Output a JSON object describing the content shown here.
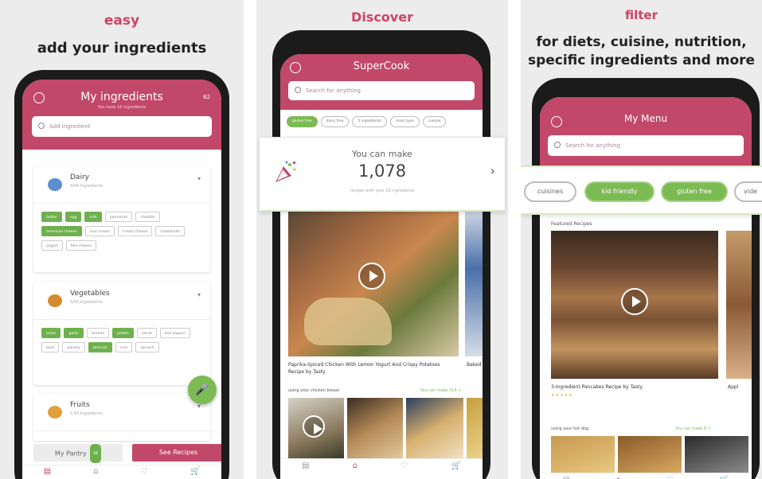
{
  "panel1": {
    "accent": "easy",
    "headline": "add your ingredients",
    "screen": {
      "title": "My ingredients",
      "subtitle": "You have 16 ingredients",
      "count_badge": "62",
      "search_placeholder": "Add ingredient",
      "groups": [
        {
          "name": "Dairy",
          "count": "4/44 Ingredients",
          "icon_color": "#5a8fd1",
          "chips": [
            {
              "label": "butter",
              "on": true
            },
            {
              "label": "egg",
              "on": true
            },
            {
              "label": "milk",
              "on": true
            },
            {
              "label": "parmesan",
              "on": false
            },
            {
              "label": "cheddar",
              "on": false
            },
            {
              "label": "american cheese",
              "on": true
            },
            {
              "label": "sour cream",
              "on": false
            },
            {
              "label": "cream cheese",
              "on": false
            },
            {
              "label": "mozzarella",
              "on": false
            },
            {
              "label": "yogurt",
              "on": false
            },
            {
              "label": "feta cheese",
              "on": false
            }
          ]
        },
        {
          "name": "Vegetables",
          "count": "6/93 Ingredients",
          "icon_color": "#d48a2a",
          "chips": [
            {
              "label": "onion",
              "on": true
            },
            {
              "label": "garlic",
              "on": true
            },
            {
              "label": "tomato",
              "on": false
            },
            {
              "label": "potato",
              "on": true
            },
            {
              "label": "carrot",
              "on": false
            },
            {
              "label": "bell pepper",
              "on": false
            },
            {
              "label": "basil",
              "on": false
            },
            {
              "label": "parsley",
              "on": false
            },
            {
              "label": "broccoli",
              "on": true
            },
            {
              "label": "corn",
              "on": false
            },
            {
              "label": "spinach",
              "on": false
            }
          ]
        },
        {
          "name": "Fruits",
          "count": "1/43 Ingredients",
          "icon_color": "#e0a03a",
          "chips": []
        }
      ],
      "pantry_label": "My Pantry",
      "pantry_badge": "16",
      "see_recipes": "See Recipes",
      "nav": [
        "▤",
        "⌂",
        "♡",
        "🛒"
      ]
    }
  },
  "panel2": {
    "accent": "Discover",
    "screen": {
      "title": "SuperCook",
      "search_placeholder": "Search for anything",
      "tags": [
        {
          "label": "gluten free",
          "on": true
        },
        {
          "label": "dairy free",
          "on": false
        },
        {
          "label": "5 ingredients",
          "on": false
        },
        {
          "label": "meal type",
          "on": false
        },
        {
          "label": "cuisine",
          "on": false
        }
      ],
      "make_label": "You can make",
      "make_count": "1,078",
      "make_sub": "recipes with your 16 ingredients",
      "recipe_title": "Paprika-Spiced Chicken With Lemon Yogurt And Crispy Potatoes Recipe by Tasty",
      "side_title": "Baked",
      "section_label": "using your chicken breast",
      "section_link": "You can make 214 >",
      "nav": [
        "▤",
        "⌂",
        "♡",
        "🛒"
      ]
    }
  },
  "panel3": {
    "accent": "filter",
    "headline": [
      "for diets, cuisine, nutrition,",
      "specific ingredients and more"
    ],
    "screen": {
      "title": "My Menu",
      "search_placeholder": "Search for anything",
      "pills": [
        {
          "label": "cuisines",
          "on": false
        },
        {
          "label": "kid friendly",
          "on": true
        },
        {
          "label": "gluten free",
          "on": true
        },
        {
          "label": "vide",
          "on": false
        }
      ],
      "featured": "Featured Recipes",
      "recipe_title": "3-Ingredient Pancakes Recipe by Tasty",
      "side_title": "Appl",
      "rating": "★★★★★",
      "section_label": "using your hot dog",
      "section_link": "You can make 8 >",
      "nav": [
        "▤",
        "⌂",
        "♡",
        "🛒"
      ]
    }
  }
}
